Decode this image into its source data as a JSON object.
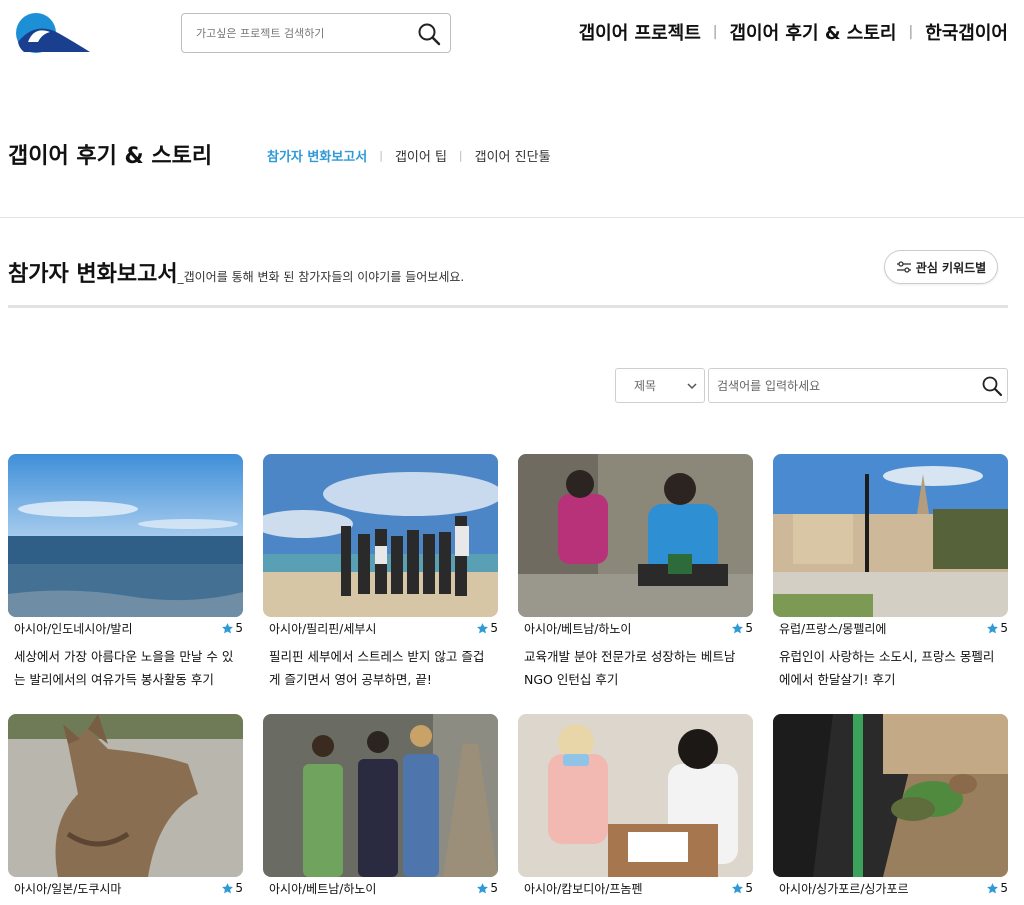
{
  "header": {
    "search_placeholder": "가고싶은 프로젝트 검색하기",
    "nav": [
      "갭이어 프로젝트",
      "갭이어 후기 & 스토리",
      "한국갭이어"
    ],
    "logo_icon": "whale-logo-icon"
  },
  "section": {
    "title": "갭이어 후기 & 스토리",
    "subnav": [
      {
        "label": "참가자 변화보고서",
        "active": true
      },
      {
        "label": "갭이어 팁",
        "active": false
      },
      {
        "label": "갭이어 진단툴",
        "active": false
      }
    ]
  },
  "page": {
    "heading": "참가자 변화보고서",
    "description": "_갭이어를 통해 변화 된 참가자들의 이야기를 들어보세요.",
    "keyword_button": "관심 키워드별"
  },
  "filter": {
    "select_value": "제목",
    "search_placeholder": "검색어를 입력하세요"
  },
  "colors": {
    "accent": "#2f9ad6",
    "star": "#2f9ad6"
  },
  "cards": [
    {
      "location": "아시아/인도네시아/발리",
      "rating": "5",
      "title": "세상에서 가장 아름다운 노을을 만날 수 있는 발리에서의 여유가득 봉사활동 후기"
    },
    {
      "location": "아시아/필리핀/세부시",
      "rating": "5",
      "title": "필리핀 세부에서 스트레스 받지 않고 즐겁게 즐기면서 영어 공부하면, 끝!"
    },
    {
      "location": "아시아/베트남/하노이",
      "rating": "5",
      "title": "교육개발 분야 전문가로 성장하는 베트남 NGO 인턴십 후기"
    },
    {
      "location": "유럽/프랑스/몽펠리에",
      "rating": "5",
      "title": "유럽인이 사랑하는 소도시, 프랑스 몽펠리에에서 한달살기! 후기"
    },
    {
      "location": "아시아/일본/도쿠시마",
      "rating": "5",
      "title": ""
    },
    {
      "location": "아시아/베트남/하노이",
      "rating": "5",
      "title": ""
    },
    {
      "location": "아시아/캄보디아/프놈펜",
      "rating": "5",
      "title": ""
    },
    {
      "location": "아시아/싱가포르/싱가포르",
      "rating": "5",
      "title": ""
    }
  ]
}
